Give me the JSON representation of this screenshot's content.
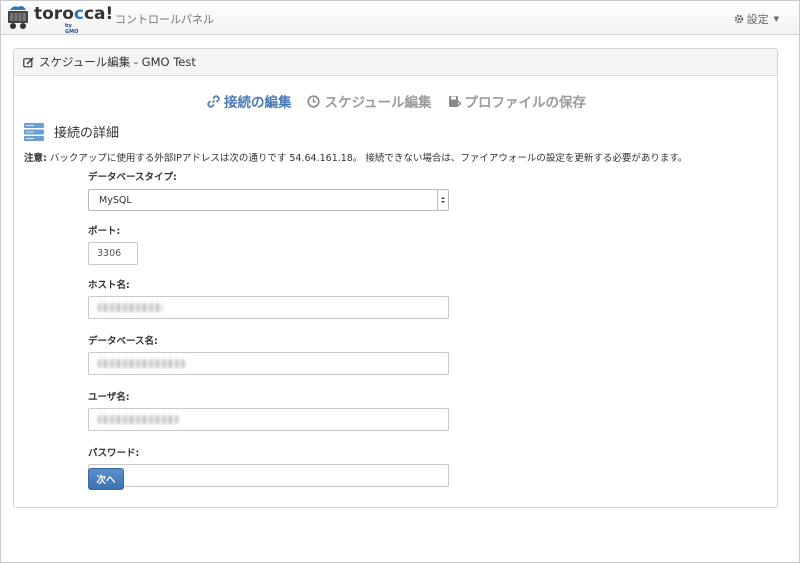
{
  "brand": {
    "name_prefix": "toro",
    "name_highlight": "c",
    "name_suffix": "ca!",
    "sub": "by GMO"
  },
  "nav": {
    "title": "コントロールパネル",
    "settings_label": "設定"
  },
  "panel": {
    "title": "スケジュール編集 - GMO Test"
  },
  "steps": [
    {
      "label": "接続の編集",
      "active": true
    },
    {
      "label": "スケジュール編集",
      "active": false
    },
    {
      "label": "プロファイルの保存",
      "active": false
    }
  ],
  "section": {
    "title": "接続の詳細"
  },
  "notice": {
    "prefix": "注意:",
    "text": " バックアップに使用する外部IPアドレスは次の通りです 54.64.161.18。 接続できない場合は、ファイアウォールの設定を更新する必要があります。"
  },
  "form": {
    "db_type": {
      "label": "データベースタイプ:",
      "value": "MySQL"
    },
    "port": {
      "label": "ポート:",
      "value": "3306"
    },
    "host": {
      "label": "ホスト名:",
      "value": ""
    },
    "db_name": {
      "label": "データベース名:",
      "value": ""
    },
    "user": {
      "label": "ユーザ名:",
      "value": ""
    },
    "password": {
      "label": "パスワード:",
      "value": ""
    },
    "next_button": "次へ"
  },
  "colors": {
    "accent": "#4a79b1",
    "button": "#3c72b3",
    "muted": "#9a9a9a"
  }
}
